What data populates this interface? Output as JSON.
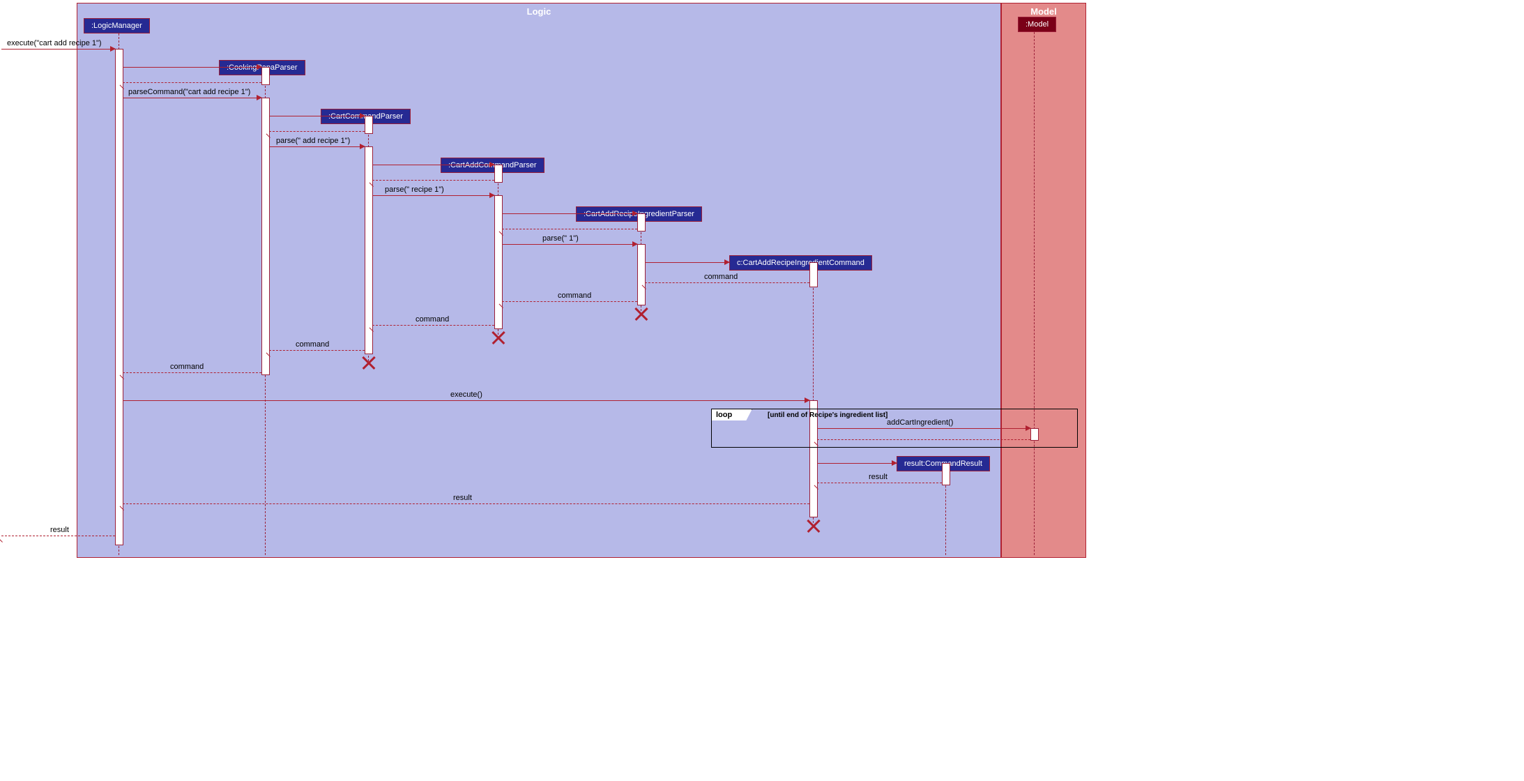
{
  "frames": {
    "logic": "Logic",
    "model": "Model"
  },
  "participants": {
    "logicManager": ":LogicManager",
    "cookingPapaParser": ":CookingPapaParser",
    "cartCommandParser": ":CartCommandParser",
    "cartAddCommandParser": ":CartAddCommandParser",
    "cartAddRecipeIngredientParser": ":CartAddRecipeIngredientParser",
    "cartAddRecipeIngredientCommand": "c:CartAddRecipeIngredientCommand",
    "commandResult": "result:CommandResult",
    "modelObj": ":Model"
  },
  "messages": {
    "execEntry": "execute(\"cart add recipe 1\")",
    "parseCommand": "parseCommand(\"cart add recipe 1\")",
    "parse1": "parse(\" add recipe 1\")",
    "parse2": "parse(\" recipe 1\")",
    "parse3": "parse(\" 1\")",
    "command": "command",
    "execute": "execute()",
    "addCartIngredient": "addCartIngredient()",
    "result": "result"
  },
  "loop": {
    "keyword": "loop",
    "condition": "[until end of Recipe's ingredient list]"
  }
}
